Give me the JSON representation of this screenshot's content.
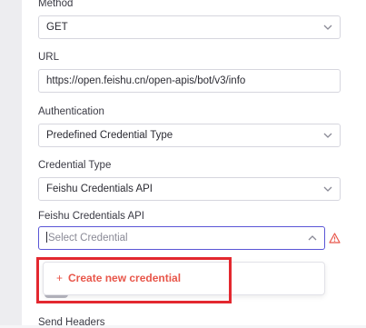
{
  "fields": {
    "method": {
      "label": "Method",
      "value": "GET"
    },
    "url": {
      "label": "URL",
      "value": "https://open.feishu.cn/open-apis/bot/v3/info"
    },
    "authentication": {
      "label": "Authentication",
      "value": "Predefined Credential Type"
    },
    "credential_type": {
      "label": "Credential Type",
      "value": "Feishu Credentials API"
    },
    "credential": {
      "label": "Feishu Credentials API",
      "placeholder": "Select Credential"
    }
  },
  "dropdown": {
    "options": [
      {
        "icon": "plus-icon",
        "glyph": "+",
        "label": "Create new credential"
      }
    ]
  },
  "send_headers": {
    "label": "Send Headers"
  },
  "colors": {
    "accent": "#5a56d6",
    "create_option": "#e8564a",
    "highlight_box": "#e3282f",
    "warning": "#e8564a"
  }
}
